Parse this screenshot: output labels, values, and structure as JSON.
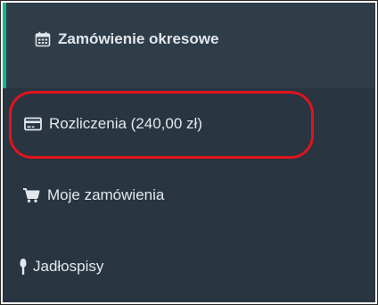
{
  "sidebar": {
    "items": [
      {
        "label": "Zamówienie okresowe",
        "icon": "calendar-icon",
        "active": true
      },
      {
        "label": "Rozliczenia (240,00 zł)",
        "icon": "credit-card-icon"
      },
      {
        "label": "Moje zamówienia",
        "icon": "shopping-cart-icon"
      },
      {
        "label": "Jadłospisy",
        "icon": "cutlery-icon"
      }
    ]
  },
  "colors": {
    "sidebar_bg": "#2f3d48",
    "item_bg": "#293540",
    "active_accent": "#17b48a",
    "text": "#e1e7ec",
    "annotation": "#e0141e"
  }
}
